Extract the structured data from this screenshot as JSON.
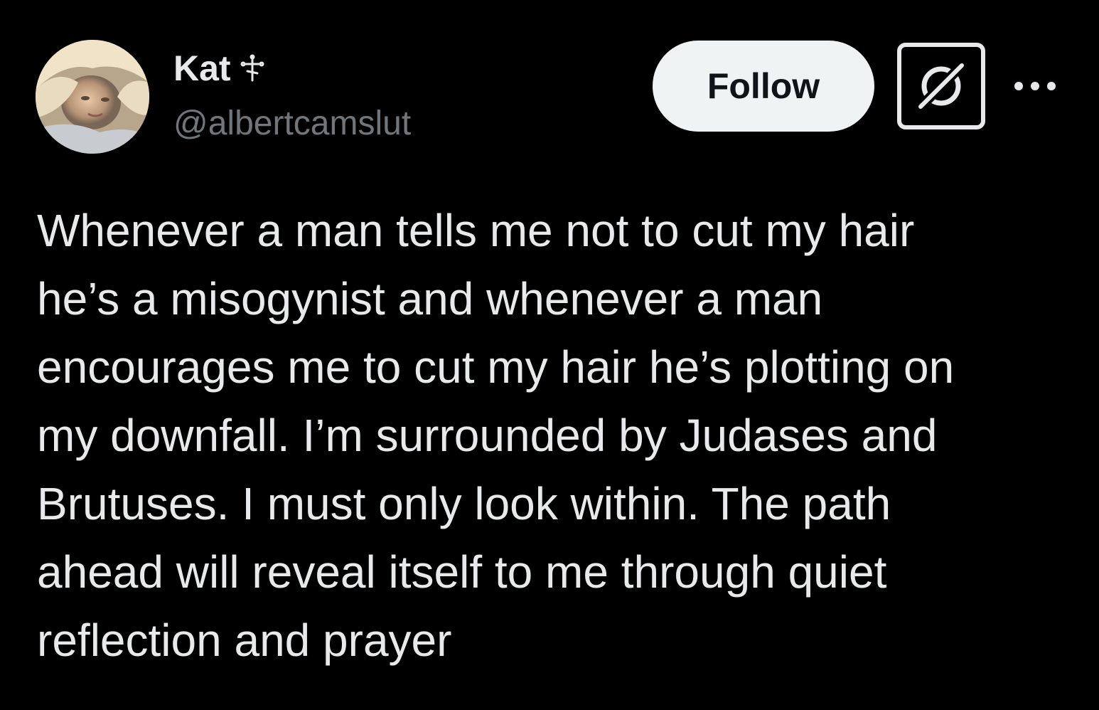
{
  "author": {
    "display_name": "Kat",
    "badge_icon": "orthodox-cross-icon",
    "handle": "@albertcamslut",
    "avatar_icon": "profile-photo"
  },
  "actions": {
    "follow_label": "Follow",
    "grok_icon": "grok-icon",
    "more_icon": "more-icon"
  },
  "tweet": {
    "lines": [
      "Whenever a man tells me not to cut my hair",
      "he’s a misogynist and whenever a man",
      "encourages me to cut my hair he’s plotting on",
      "my downfall. I’m surrounded by Judases and",
      "Brutuses. I must only look within. The path",
      "ahead will reveal itself to me through quiet",
      "reflection and prayer"
    ]
  },
  "colors": {
    "background": "#000000",
    "text_primary": "#e7e9ea",
    "text_secondary": "#71767b",
    "follow_bg": "#eff3f4",
    "follow_text": "#0f1419"
  }
}
